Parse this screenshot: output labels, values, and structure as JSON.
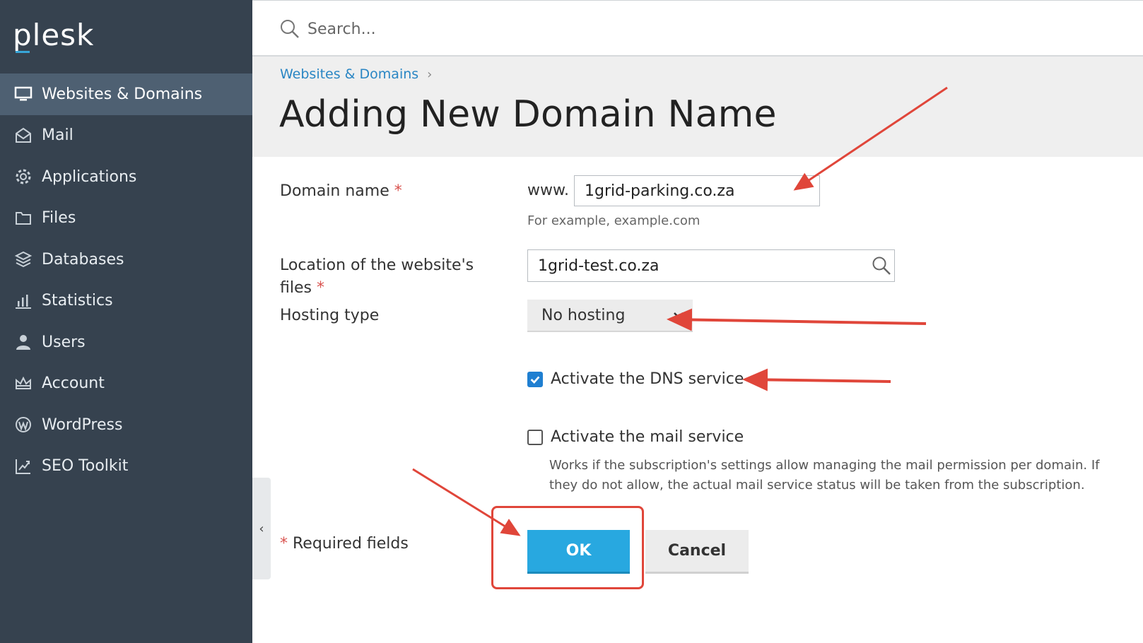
{
  "app": {
    "logo": "plesk"
  },
  "search": {
    "placeholder": "Search..."
  },
  "sidebar": {
    "items": [
      {
        "label": "Websites & Domains",
        "icon": "monitor-icon",
        "active": true
      },
      {
        "label": "Mail",
        "icon": "mail-icon"
      },
      {
        "label": "Applications",
        "icon": "gear-icon"
      },
      {
        "label": "Files",
        "icon": "folder-icon"
      },
      {
        "label": "Databases",
        "icon": "database-icon"
      },
      {
        "label": "Statistics",
        "icon": "bar-chart-icon"
      },
      {
        "label": "Users",
        "icon": "user-icon"
      },
      {
        "label": "Account",
        "icon": "crown-icon"
      },
      {
        "label": "WordPress",
        "icon": "wordpress-icon"
      },
      {
        "label": "SEO Toolkit",
        "icon": "seo-chart-icon"
      }
    ],
    "collapse_glyph": "‹"
  },
  "breadcrumb": {
    "item": "Websites & Domains",
    "separator": "›"
  },
  "page": {
    "title": "Adding New Domain Name"
  },
  "form": {
    "domain_label": "Domain name",
    "required_marker": "*",
    "www_prefix": "www.",
    "domain_value": "1grid-parking.co.za",
    "domain_hint": "For example, example.com",
    "location_label_line1": "Location of the website's",
    "location_label_line2": "files",
    "location_value": "1grid-test.co.za",
    "hosting_label": "Hosting type",
    "hosting_value": "No hosting",
    "dns_label": "Activate the DNS service",
    "dns_checked": true,
    "mail_label": "Activate the mail service",
    "mail_checked": false,
    "mail_desc_line1": "Works if the subscription's settings allow managing the mail permission per domain. If",
    "mail_desc_line2": "they do not allow, the actual mail service status will be taken from the subscription.",
    "required_note": "Required fields",
    "ok_label": "OK",
    "cancel_label": "Cancel"
  },
  "colors": {
    "sidebar_bg": "#36424f",
    "sidebar_active": "#4e6072",
    "accent_blue": "#28a8e0",
    "link_blue": "#2a86c4",
    "annotation_red": "#e0463a"
  }
}
